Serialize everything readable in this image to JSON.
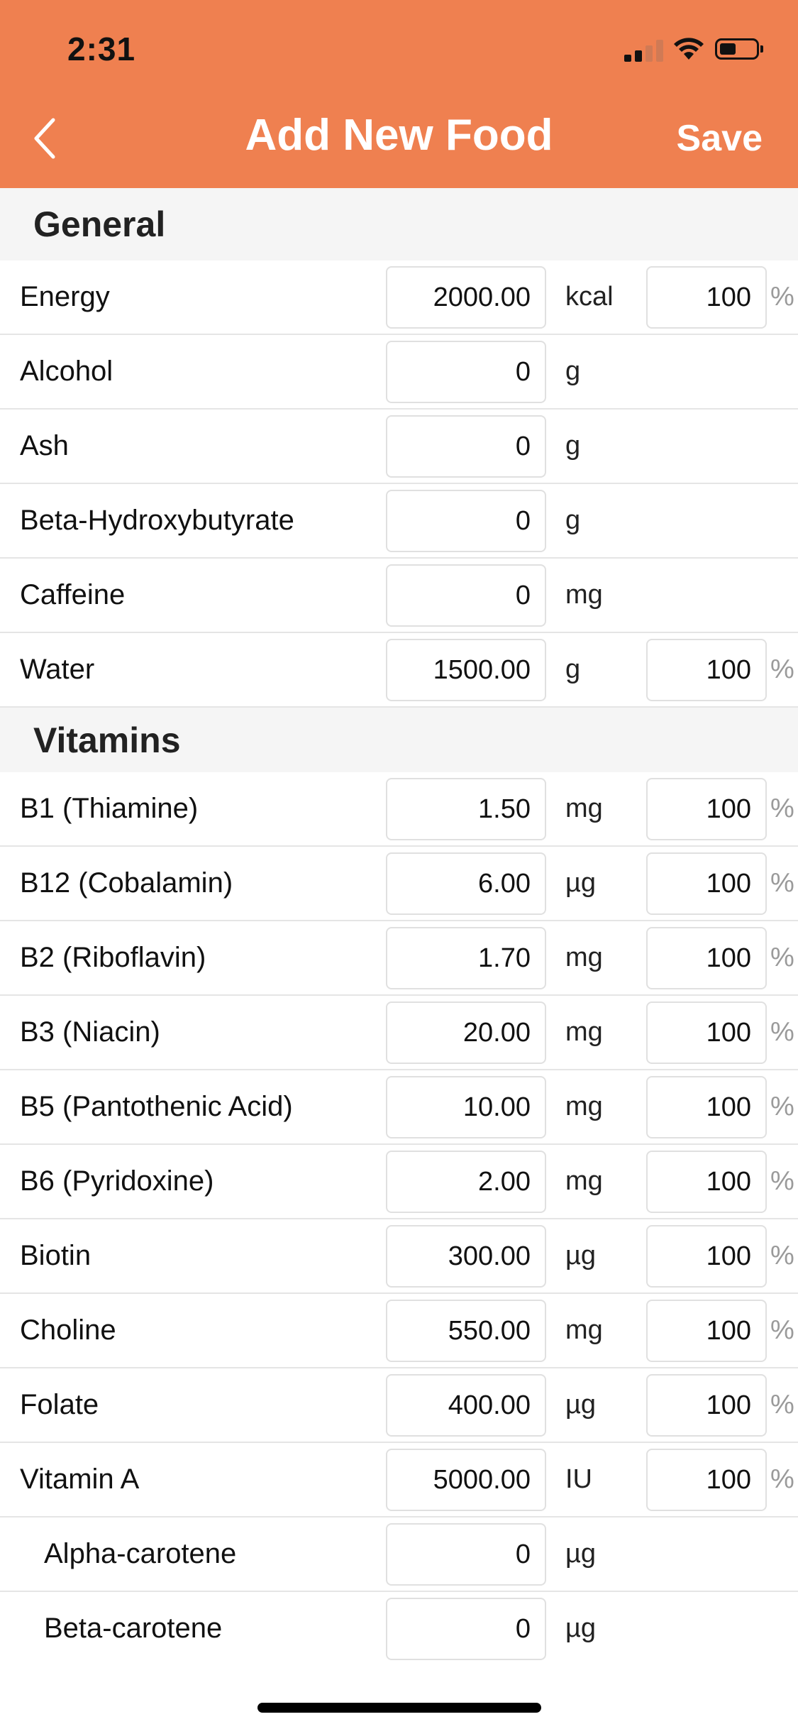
{
  "status_bar": {
    "time": "2:31",
    "icons": [
      "cellular-signal-icon",
      "wifi-icon",
      "battery-icon"
    ]
  },
  "nav": {
    "back_icon": "chevron-left-icon",
    "title": "Add New Food",
    "save_label": "Save"
  },
  "colors": {
    "accent": "#EF8050",
    "section_bg": "#F5F5F5",
    "separator": "#E5E5E5",
    "percent_symbol": "#9a9a9a"
  },
  "sections": {
    "general": {
      "title": "General",
      "rows": {
        "energy": {
          "label": "Energy",
          "value": "2000.00",
          "unit": "kcal",
          "percent": "100",
          "percent_symbol": "%"
        },
        "alcohol": {
          "label": "Alcohol",
          "value": "0",
          "unit": "g"
        },
        "ash": {
          "label": "Ash",
          "value": "0",
          "unit": "g"
        },
        "bhb": {
          "label": "Beta-Hydroxybutyrate",
          "value": "0",
          "unit": "g"
        },
        "caffeine": {
          "label": "Caffeine",
          "value": "0",
          "unit": "mg"
        },
        "water": {
          "label": "Water",
          "value": "1500.00",
          "unit": "g",
          "percent": "100",
          "percent_symbol": "%"
        }
      }
    },
    "vitamins": {
      "title": "Vitamins",
      "rows": {
        "b1": {
          "label": "B1 (Thiamine)",
          "value": "1.50",
          "unit": "mg",
          "percent": "100",
          "percent_symbol": "%"
        },
        "b12": {
          "label": "B12 (Cobalamin)",
          "value": "6.00",
          "unit": "µg",
          "percent": "100",
          "percent_symbol": "%"
        },
        "b2": {
          "label": "B2 (Riboflavin)",
          "value": "1.70",
          "unit": "mg",
          "percent": "100",
          "percent_symbol": "%"
        },
        "b3": {
          "label": "B3 (Niacin)",
          "value": "20.00",
          "unit": "mg",
          "percent": "100",
          "percent_symbol": "%"
        },
        "b5": {
          "label": "B5 (Pantothenic Acid)",
          "value": "10.00",
          "unit": "mg",
          "percent": "100",
          "percent_symbol": "%"
        },
        "b6": {
          "label": "B6 (Pyridoxine)",
          "value": "2.00",
          "unit": "mg",
          "percent": "100",
          "percent_symbol": "%"
        },
        "biotin": {
          "label": "Biotin",
          "value": "300.00",
          "unit": "µg",
          "percent": "100",
          "percent_symbol": "%"
        },
        "choline": {
          "label": "Choline",
          "value": "550.00",
          "unit": "mg",
          "percent": "100",
          "percent_symbol": "%"
        },
        "folate": {
          "label": "Folate",
          "value": "400.00",
          "unit": "µg",
          "percent": "100",
          "percent_symbol": "%"
        },
        "vitamin_a": {
          "label": "Vitamin A",
          "value": "5000.00",
          "unit": "IU",
          "percent": "100",
          "percent_symbol": "%"
        },
        "alpha_carotene": {
          "label": "Alpha-carotene",
          "value": "0",
          "unit": "µg"
        },
        "beta_carotene": {
          "label": "Beta-carotene",
          "value": "0",
          "unit": "µg"
        }
      }
    }
  }
}
